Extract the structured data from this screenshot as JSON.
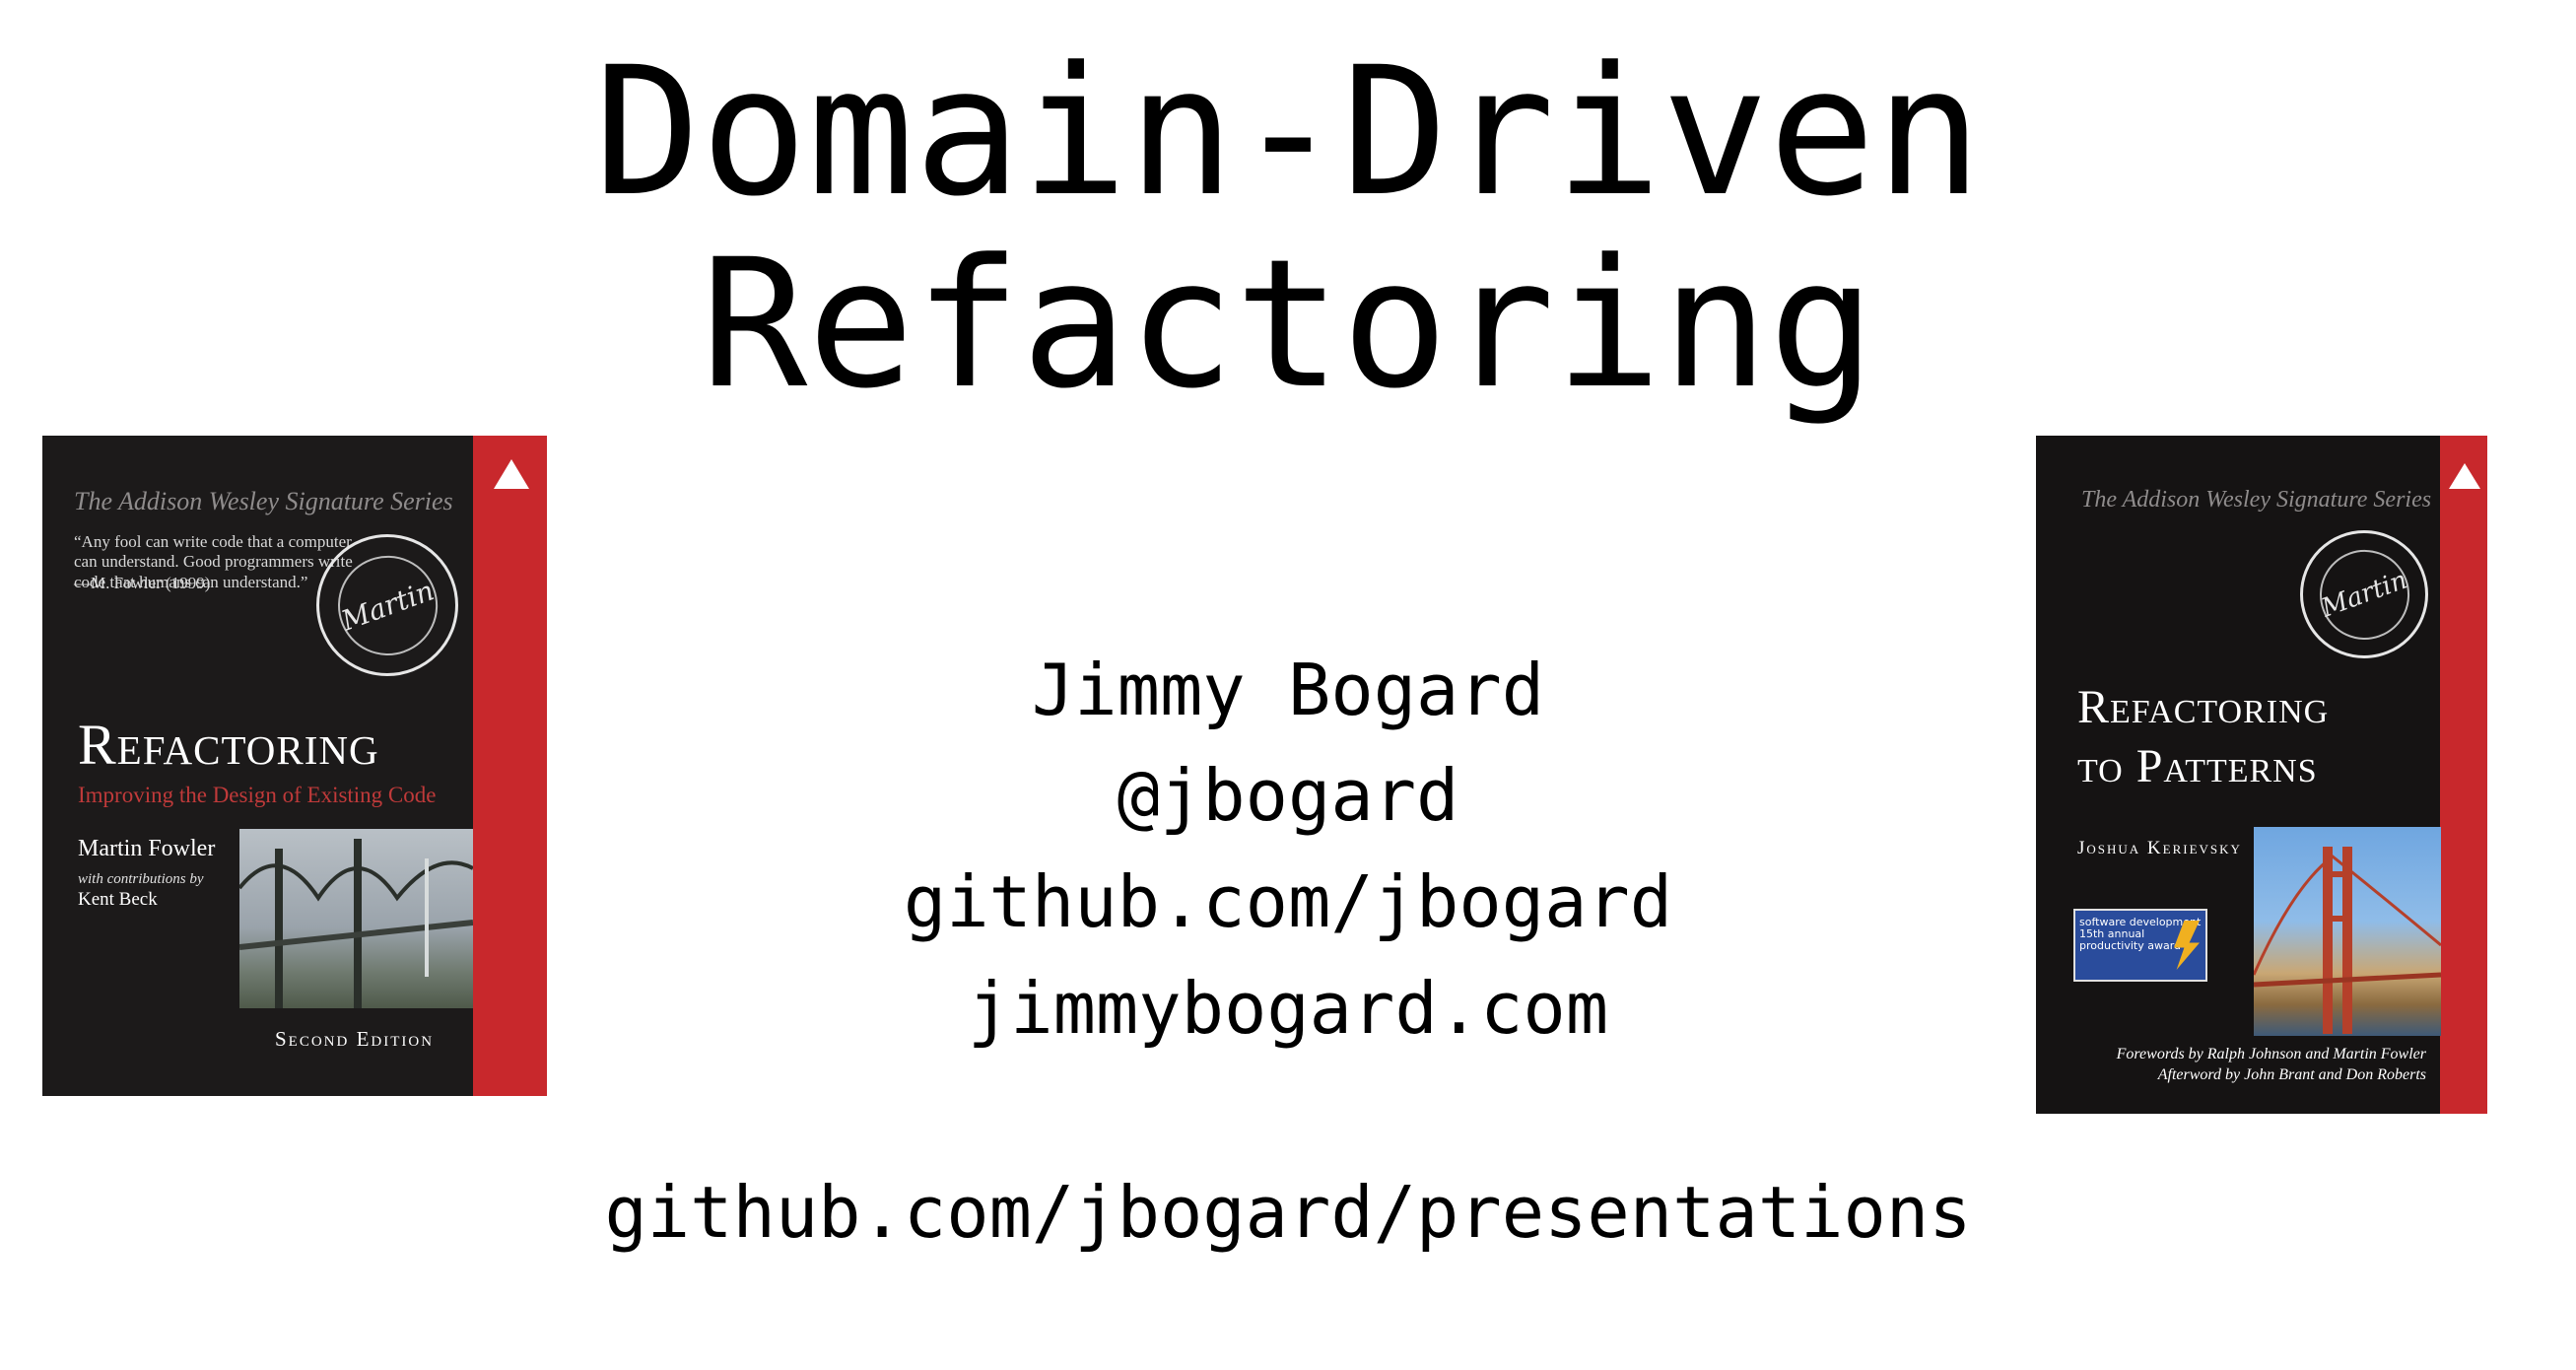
{
  "title": {
    "line1": "Domain-Driven",
    "line2": "Refactoring"
  },
  "author": {
    "name": "Jimmy Bogard",
    "handle": "@jbogard",
    "github": "github.com/jbogard",
    "site": "jimmybogard.com"
  },
  "presentations_link": "github.com/jbogard/presentations",
  "books": [
    {
      "series": "The Addison Wesley Signature Series",
      "quote": "“Any fool can write code that a computer can understand. Good programmers write code that humans can understand.”",
      "quote_attribution": "—M. Fowler (1999)",
      "seal_text": "Martin",
      "title": "Refactoring",
      "subtitle": "Improving the Design of Existing Code",
      "author": "Martin Fowler",
      "contributions_label": "with contributions by",
      "contributor": "Kent Beck",
      "edition": "Second Edition"
    },
    {
      "series": "The Addison Wesley Signature Series",
      "seal_text": "Martin",
      "title_line1": "Refactoring",
      "title_line2": "to Patterns",
      "author": "Joshua Kerievsky",
      "badge_text": "software development 15th annual productivity award",
      "forewords_line1": "Forewords by Ralph Johnson and Martin Fowler",
      "forewords_line2": "Afterword by John Brant and Don Roberts"
    }
  ],
  "colors": {
    "background": "#ffffff",
    "text": "#000000",
    "cover_dark": "#1c1a1a",
    "cover_stripe": "#c8282c"
  }
}
